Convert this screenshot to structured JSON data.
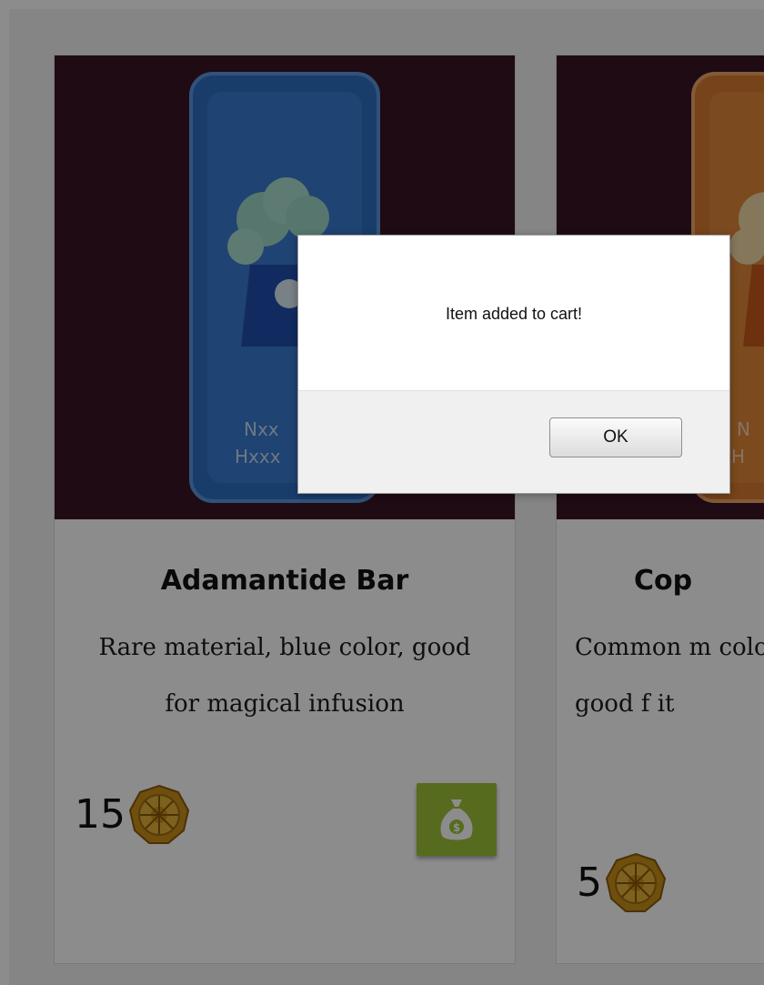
{
  "products": [
    {
      "name": "Adamantide Bar",
      "description": "Rare material, blue color, good for magical infusion",
      "price": "15",
      "currency_icon": "coin-icon",
      "buy_icon": "money-bag-icon",
      "bar_color": "#3b7bd0"
    },
    {
      "name": "Cop",
      "description": "Common m color, good f it",
      "price": "5",
      "currency_icon": "coin-icon",
      "bar_color": "#e0893c"
    }
  ],
  "colors": {
    "image_bg": "#3a1525",
    "buy_button": "#9ec43a",
    "coin": "#d9a521"
  },
  "dialog": {
    "message": "Item added to cart!",
    "ok_label": "OK"
  }
}
